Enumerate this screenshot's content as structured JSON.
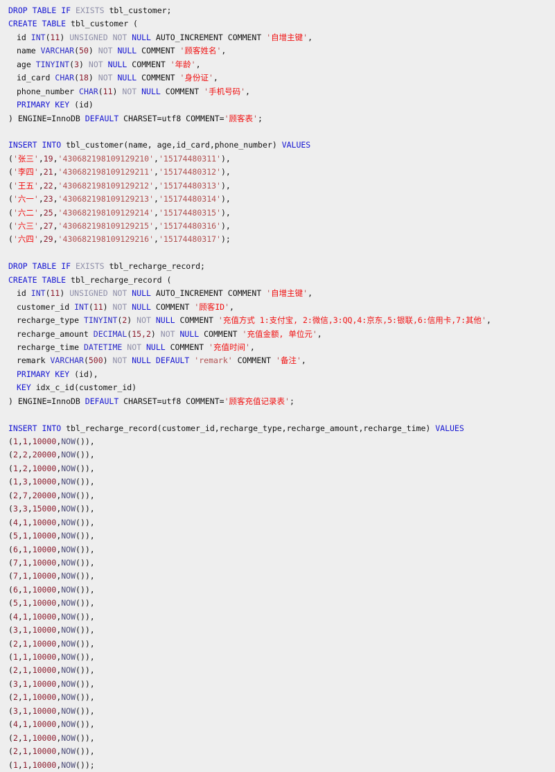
{
  "document": {
    "kind": "sql-script",
    "language": "SQL",
    "background_color": "#eeeeee",
    "colors": {
      "keyword": "#1414d2",
      "keyword_dim": "#8e8ea8",
      "type": "#2b2bc8",
      "number": "#8b1a2b",
      "string_highlight": "#f01010",
      "string_plain": "#b05050",
      "function": "#4b4b78",
      "plain": "#101010"
    },
    "tables": [
      {
        "name": "tbl_customer",
        "comment": "顾客表",
        "engine": "InnoDB",
        "charset": "utf8",
        "columns": [
          {
            "name": "id",
            "type": "INT(11)",
            "attrs": "UNSIGNED NOT NULL AUTO_INCREMENT",
            "comment": "自增主键"
          },
          {
            "name": "name",
            "type": "VARCHAR(50)",
            "attrs": "NOT NULL",
            "comment": "顾客姓名"
          },
          {
            "name": "age",
            "type": "TINYINT(3)",
            "attrs": "NOT NULL",
            "comment": "年龄"
          },
          {
            "name": "id_card",
            "type": "CHAR(18)",
            "attrs": "NOT NULL",
            "comment": "身份证"
          },
          {
            "name": "phone_number",
            "type": "CHAR(11)",
            "attrs": "NOT NULL",
            "comment": "手机号码"
          }
        ],
        "primary_key": "id"
      },
      {
        "name": "tbl_recharge_record",
        "comment": "顾客充值记录表",
        "engine": "InnoDB",
        "charset": "utf8",
        "columns": [
          {
            "name": "id",
            "type": "INT(11)",
            "attrs": "UNSIGNED NOT NULL AUTO_INCREMENT",
            "comment": "自增主键"
          },
          {
            "name": "customer_id",
            "type": "INT(11)",
            "attrs": "NOT NULL",
            "comment": "顾客ID"
          },
          {
            "name": "recharge_type",
            "type": "TINYINT(2)",
            "attrs": "NOT NULL",
            "comment": "充值方式 1:支付宝, 2:微信,3:QQ,4:京东,5:银联,6:信用卡,7:其他"
          },
          {
            "name": "recharge_amount",
            "type": "DECIMAL(15,2)",
            "attrs": "NOT NULL",
            "comment": "充值金额, 单位元"
          },
          {
            "name": "recharge_time",
            "type": "DATETIME",
            "attrs": "NOT NULL",
            "comment": "充值时间"
          },
          {
            "name": "remark",
            "type": "VARCHAR(500)",
            "attrs": "NOT NULL DEFAULT 'remark'",
            "comment": "备注"
          }
        ],
        "primary_key": "id",
        "index": {
          "name": "idx_c_id",
          "column": "customer_id"
        }
      }
    ],
    "customer_rows": [
      {
        "name": "张三",
        "age": "19",
        "id_card": "430682198109129210",
        "phone": "15174480311"
      },
      {
        "name": "李四",
        "age": "21",
        "id_card": "430682198109129211",
        "phone": "15174480312"
      },
      {
        "name": "王五",
        "age": "22",
        "id_card": "430682198109129212",
        "phone": "15174480313"
      },
      {
        "name": "六一",
        "age": "23",
        "id_card": "430682198109129213",
        "phone": "15174480314"
      },
      {
        "name": "六二",
        "age": "25",
        "id_card": "430682198109129214",
        "phone": "15174480315"
      },
      {
        "name": "六三",
        "age": "27",
        "id_card": "430682198109129215",
        "phone": "15174480316"
      },
      {
        "name": "六四",
        "age": "29",
        "id_card": "430682198109129216",
        "phone": "15174480317"
      }
    ],
    "recharge_rows": [
      {
        "customer_id": "1",
        "type": "1",
        "amount": "10000"
      },
      {
        "customer_id": "2",
        "type": "2",
        "amount": "20000"
      },
      {
        "customer_id": "1",
        "type": "2",
        "amount": "10000"
      },
      {
        "customer_id": "1",
        "type": "3",
        "amount": "10000"
      },
      {
        "customer_id": "2",
        "type": "7",
        "amount": "20000"
      },
      {
        "customer_id": "3",
        "type": "3",
        "amount": "15000"
      },
      {
        "customer_id": "4",
        "type": "1",
        "amount": "10000"
      },
      {
        "customer_id": "5",
        "type": "1",
        "amount": "10000"
      },
      {
        "customer_id": "6",
        "type": "1",
        "amount": "10000"
      },
      {
        "customer_id": "7",
        "type": "1",
        "amount": "10000"
      },
      {
        "customer_id": "7",
        "type": "1",
        "amount": "10000"
      },
      {
        "customer_id": "6",
        "type": "1",
        "amount": "10000"
      },
      {
        "customer_id": "5",
        "type": "1",
        "amount": "10000"
      },
      {
        "customer_id": "4",
        "type": "1",
        "amount": "10000"
      },
      {
        "customer_id": "3",
        "type": "1",
        "amount": "10000"
      },
      {
        "customer_id": "2",
        "type": "1",
        "amount": "10000"
      },
      {
        "customer_id": "1",
        "type": "1",
        "amount": "10000"
      },
      {
        "customer_id": "2",
        "type": "1",
        "amount": "10000"
      },
      {
        "customer_id": "3",
        "type": "1",
        "amount": "10000"
      },
      {
        "customer_id": "2",
        "type": "1",
        "amount": "10000"
      },
      {
        "customer_id": "3",
        "type": "1",
        "amount": "10000"
      },
      {
        "customer_id": "4",
        "type": "1",
        "amount": "10000"
      },
      {
        "customer_id": "2",
        "type": "1",
        "amount": "10000"
      },
      {
        "customer_id": "2",
        "type": "1",
        "amount": "10000"
      },
      {
        "customer_id": "1",
        "type": "1",
        "amount": "10000"
      }
    ],
    "keywords": {
      "drop": "DROP",
      "table": "TABLE",
      "if": "IF",
      "exists": "EXISTS",
      "create": "CREATE",
      "insert": "INSERT",
      "into": "INTO",
      "values": "VALUES",
      "not": "NOT",
      "null": "NULL",
      "unsigned": "UNSIGNED",
      "auto_increment": "AUTO_INCREMENT",
      "comment": "COMMENT",
      "primary": "PRIMARY",
      "key": "KEY",
      "default": "DEFAULT",
      "engine_prefix": "ENGINE=",
      "charset_prefix": "CHARSET=",
      "comment_eq": "COMMENT=",
      "now": "NOW"
    },
    "insert_headers": {
      "customer": "tbl_customer(name, age,id_card,phone_number)",
      "recharge": "tbl_recharge_record(customer_id,recharge_type,recharge_amount,recharge_time)"
    }
  }
}
